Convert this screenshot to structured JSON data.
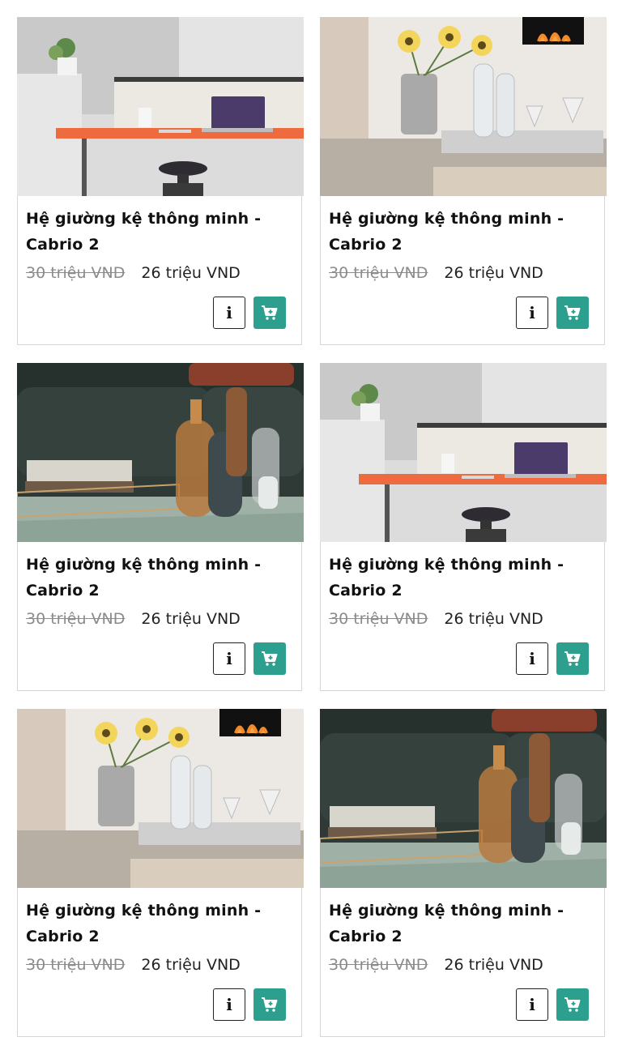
{
  "products": [
    {
      "title_line1": "Hệ giường kệ thông minh -",
      "title_line2": "Cabrio 2",
      "old_price": "30 triệu VND",
      "new_price": "26 triệu VND",
      "image": "desk-scene"
    },
    {
      "title_line1": "Hệ giường kệ thông minh -",
      "title_line2": "Cabrio 2",
      "old_price": "30 triệu VND",
      "new_price": "26 triệu VND",
      "image": "flower-table-scene"
    },
    {
      "title_line1": "Hệ giường kệ thông minh -",
      "title_line2": "Cabrio 2",
      "old_price": "30 triệu VND",
      "new_price": "26 triệu VND",
      "image": "sofa-bottles-scene"
    },
    {
      "title_line1": "Hệ giường kệ thông minh -",
      "title_line2": "Cabrio 2",
      "old_price": "30 triệu VND",
      "new_price": "26 triệu VND",
      "image": "desk-scene"
    },
    {
      "title_line1": "Hệ giường kệ thông minh -",
      "title_line2": "Cabrio 2",
      "old_price": "30 triệu VND",
      "new_price": "26 triệu VND",
      "image": "flower-table-scene"
    },
    {
      "title_line1": "Hệ giường kệ thông minh -",
      "title_line2": "Cabrio 2",
      "old_price": "30 triệu VND",
      "new_price": "26 triệu VND",
      "image": "sofa-bottles-scene"
    }
  ],
  "buttons": {
    "info_label": "i",
    "info_icon": "info-icon",
    "cart_icon": "add-to-cart-icon"
  },
  "colors": {
    "accent": "#2c9f8e",
    "old_price": "#8b8b8b",
    "border": "#d6d6d6"
  }
}
